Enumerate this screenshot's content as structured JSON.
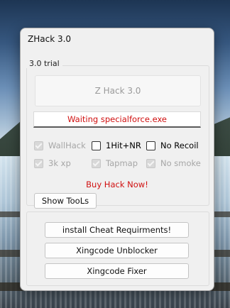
{
  "window": {
    "title": "ZHack 3.0"
  },
  "group": {
    "legend": "3.0 trial"
  },
  "main_button": {
    "label": "Z Hack 3.0"
  },
  "status": {
    "text": "Waiting specialforce.exe",
    "color": "#d01010"
  },
  "options": [
    {
      "label": "WallHack",
      "checked": true,
      "enabled": false
    },
    {
      "label": "1Hit+NR",
      "checked": false,
      "enabled": true
    },
    {
      "label": "No Recoil",
      "checked": false,
      "enabled": true
    },
    {
      "label": "3k xp",
      "checked": true,
      "enabled": false
    },
    {
      "label": "Tapmap",
      "checked": true,
      "enabled": false
    },
    {
      "label": "No smoke",
      "checked": true,
      "enabled": false
    }
  ],
  "buy": {
    "text": "Buy Hack Now!"
  },
  "tools": {
    "show_label": "Show TooLs",
    "install_label": "install Cheat Requirments!",
    "unblocker_label": "Xingcode Unblocker",
    "fixer_label": "Xingcode Fixer"
  }
}
